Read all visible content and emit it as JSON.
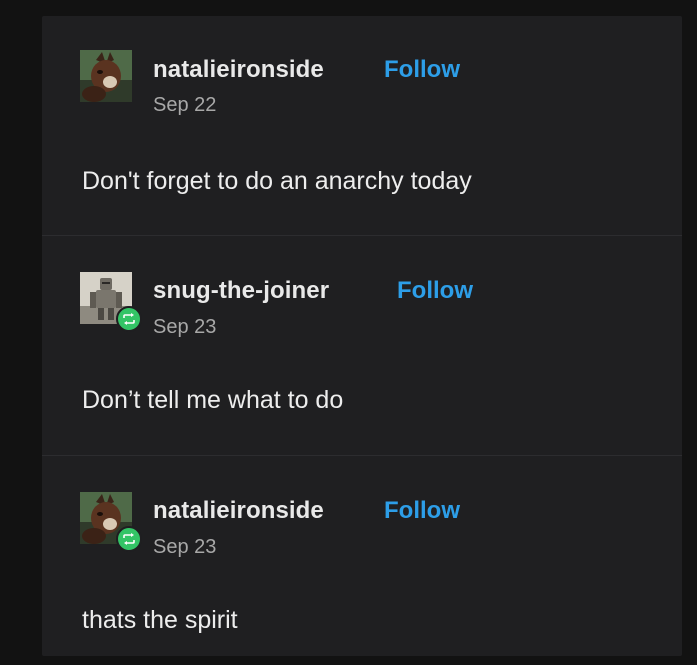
{
  "thread": {
    "posts": [
      {
        "username": "natalieironside",
        "follow_label": "Follow",
        "date": "Sep 22",
        "text": "Don't forget to do an anarchy today",
        "avatar_icon": "cat-avatar-icon",
        "reblogged": false
      },
      {
        "username": "snug-the-joiner",
        "follow_label": "Follow",
        "date": "Sep 23",
        "text": "Don’t tell me what to do",
        "avatar_icon": "knight-avatar-icon",
        "reblogged": true
      },
      {
        "username": "natalieironside",
        "follow_label": "Follow",
        "date": "Sep 23",
        "text": "thats the spirit",
        "avatar_icon": "cat-avatar-icon",
        "reblogged": true
      }
    ]
  },
  "colors": {
    "background": "#121212",
    "card": "#1f1f21",
    "follow_link": "#2d9ee8",
    "reblog_badge": "#33c466",
    "username": "#e9e9e9",
    "date": "#a8a8a8"
  }
}
